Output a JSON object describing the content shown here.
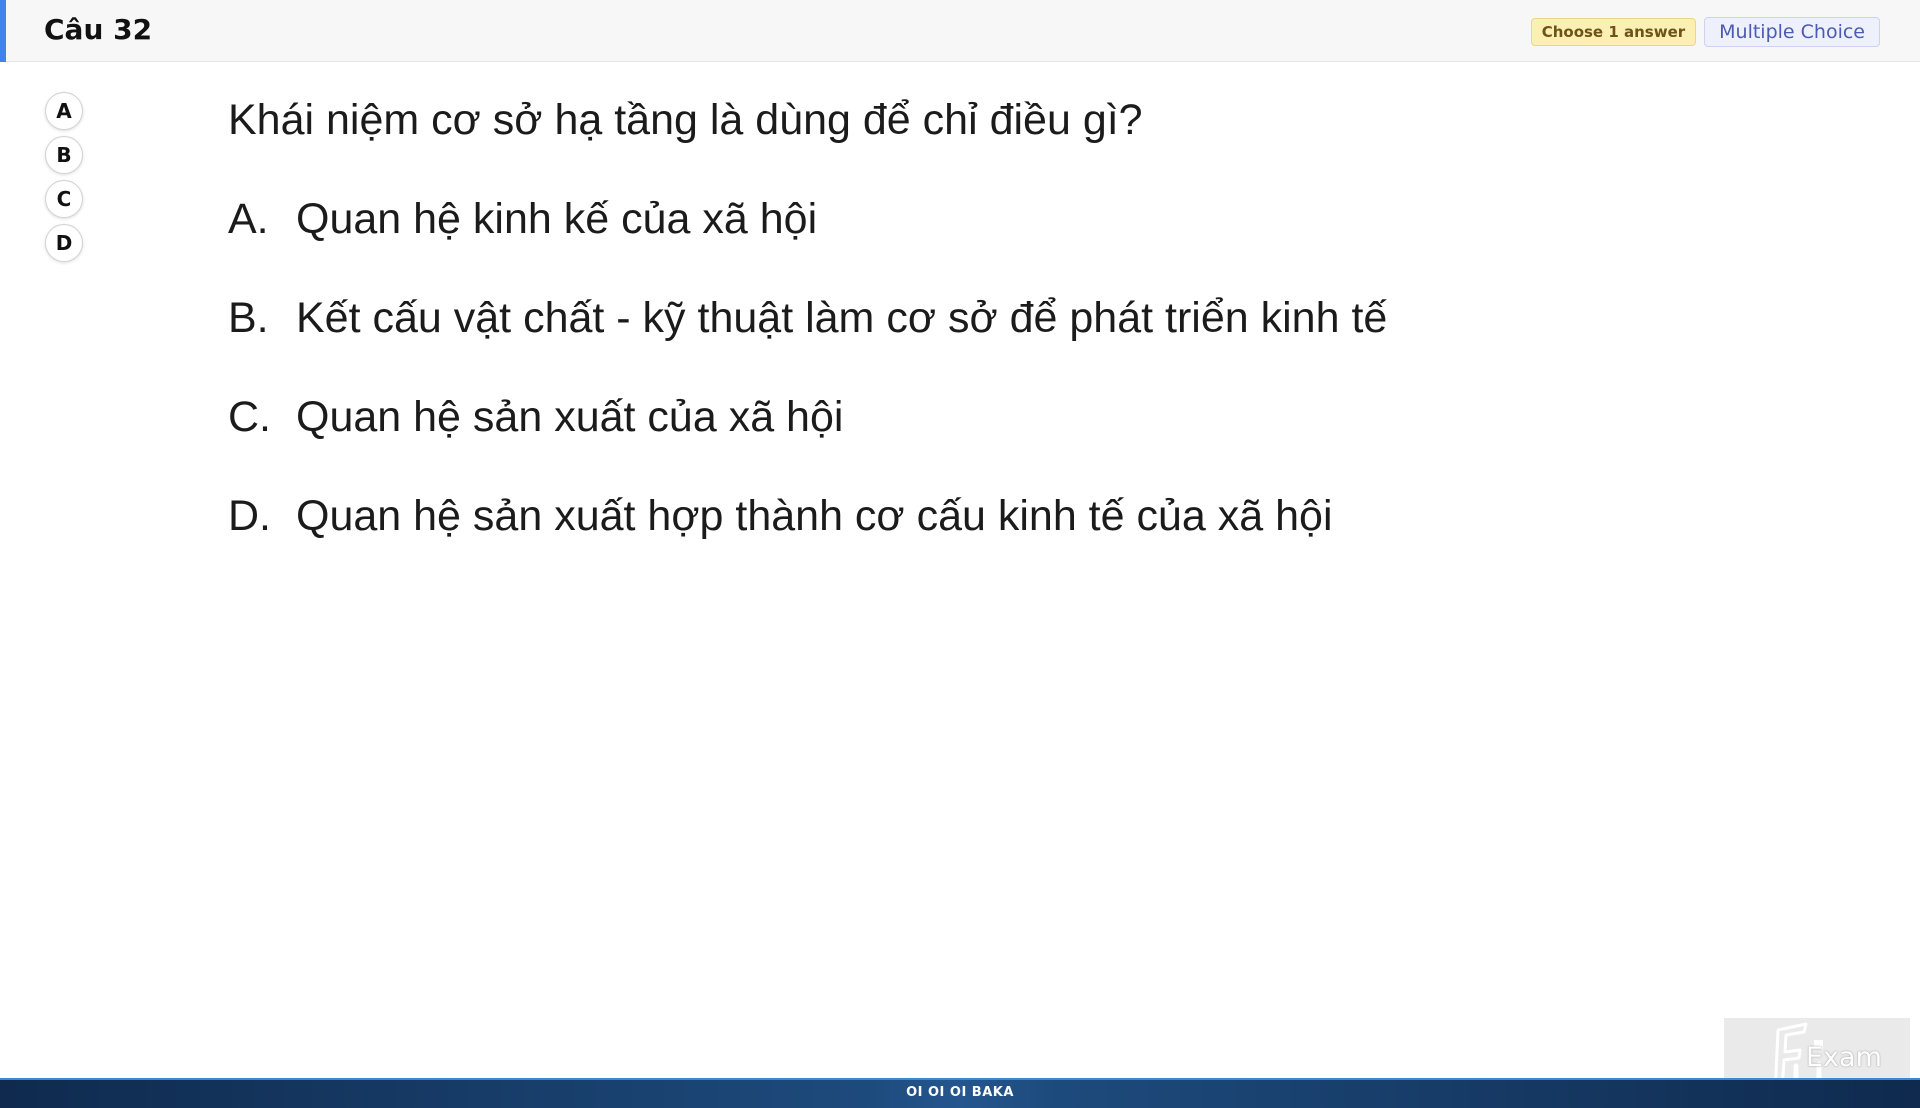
{
  "header": {
    "title": "Câu 32",
    "badge_choose": "Choose 1 answer",
    "badge_type": "Multiple Choice",
    "accent_color": "#3d85e8"
  },
  "answer_buttons": [
    "A",
    "B",
    "C",
    "D"
  ],
  "question_image": {
    "stem": "Khái niệm cơ sở hạ tầng là dùng để chỉ điều gì?",
    "options": [
      {
        "letter": "A.",
        "text": "Quan hệ kinh kế của xã hội"
      },
      {
        "letter": "B.",
        "text": "Kết cấu vật chất - kỹ thuật làm cơ sở để phát triển kinh tế"
      },
      {
        "letter": "C.",
        "text": "Quan hệ sản xuất của xã hội"
      },
      {
        "letter": "D.",
        "text": "Quan hệ sản xuất hợp thành cơ cấu kinh tế của xã hội"
      }
    ]
  },
  "footer": {
    "text": "OI OI OI BAKA"
  },
  "logo": {
    "text": "Exam",
    "icon": "fu-exam-logo"
  }
}
